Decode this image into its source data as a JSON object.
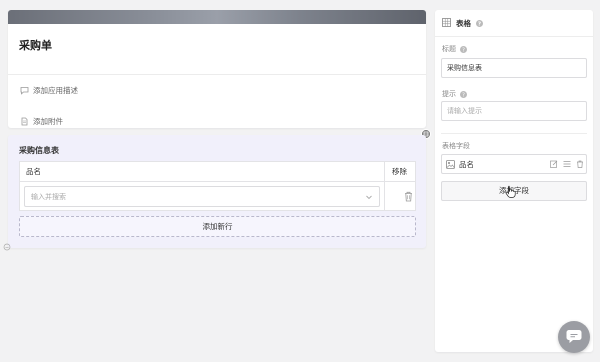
{
  "form": {
    "title": "采购单",
    "add_description": "添加应用描述",
    "add_attachment": "添加附件"
  },
  "table": {
    "title": "采购信息表",
    "columns": {
      "name": "品名",
      "remove": "移除"
    },
    "row_placeholder": "输入并搜索",
    "add_row": "添加新行"
  },
  "panel": {
    "type_label": "表格",
    "title_label": "标题",
    "title_value": "采购信息表",
    "hint_label": "提示",
    "hint_placeholder": "请输入提示",
    "fields_label": "表格字段",
    "fields": [
      {
        "label": "品名"
      }
    ],
    "add_field": "添加字段"
  },
  "icons": {
    "description": "speech-bubble-icon",
    "attachment": "document-icon",
    "dropdown": "chevron-down-icon",
    "delete": "trash-icon",
    "table": "table-icon",
    "help": "question-circle-icon",
    "field": "image-field-icon",
    "edit": "edit-icon",
    "drag": "drag-handle-icon",
    "chat": "chat-bubble-icon"
  },
  "colors": {
    "background": "#f2f2f3",
    "table_section": "#f1f0fb",
    "chat_fab": "#9b9da3"
  }
}
